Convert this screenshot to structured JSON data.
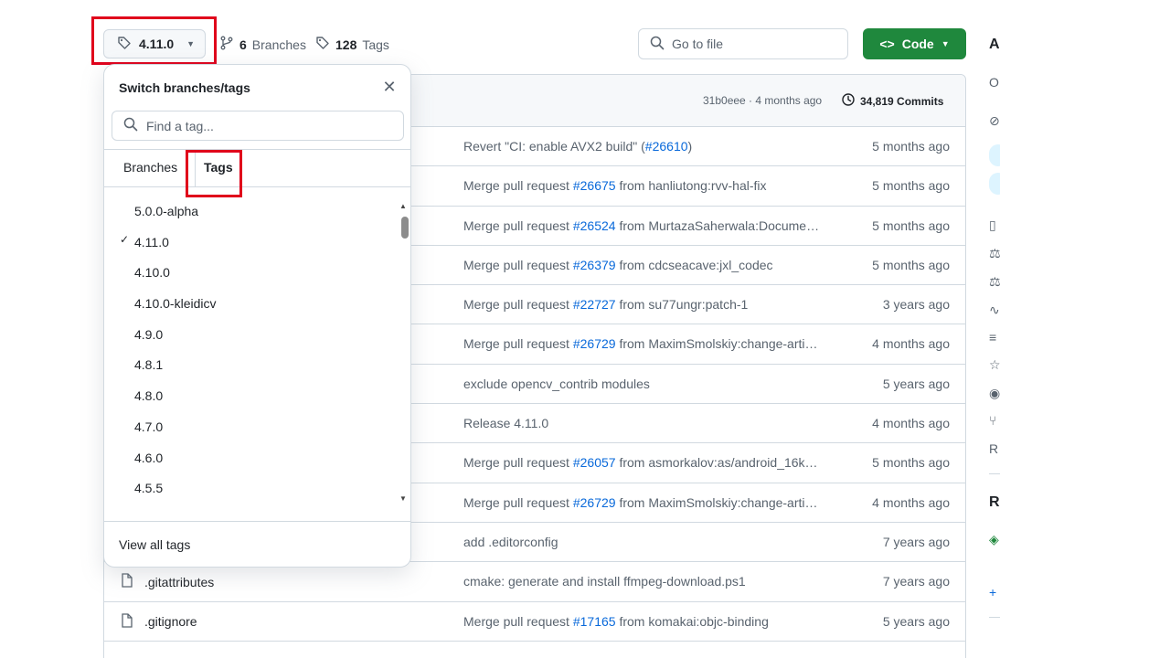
{
  "topbar": {
    "ref_label": "4.11.0",
    "branches_count": "6",
    "branches_label": "Branches",
    "tags_count": "128",
    "tags_label": "Tags",
    "goto_placeholder": "Go to file",
    "code_label": "Code"
  },
  "commit_header": {
    "last_commit": "31b0eee · 4 months ago",
    "commits_count": "34,819 Commits"
  },
  "rows": [
    {
      "name": "",
      "pre": "Revert \"CI: enable AVX2 build\" (",
      "link": "#26610",
      "post": ")",
      "age": "5 months ago"
    },
    {
      "name": "",
      "pre": "Merge pull request ",
      "link": "#26675",
      "post": " from hanliutong:rvv-hal-fix",
      "age": "5 months ago"
    },
    {
      "name": "",
      "pre": "Merge pull request ",
      "link": "#26524",
      "post": " from MurtazaSaherwala:Docume…",
      "age": "5 months ago"
    },
    {
      "name": "",
      "pre": "Merge pull request ",
      "link": "#26379",
      "post": " from cdcseacave:jxl_codec",
      "age": "5 months ago"
    },
    {
      "name": "",
      "pre": "Merge pull request ",
      "link": "#22727",
      "post": " from su77ungr:patch-1",
      "age": "3 years ago"
    },
    {
      "name": "",
      "pre": "Merge pull request ",
      "link": "#26729",
      "post": " from MaximSmolskiy:change-arti…",
      "age": "4 months ago"
    },
    {
      "name": "",
      "pre": "exclude opencv_contrib modules",
      "link": "",
      "post": "",
      "age": "5 years ago"
    },
    {
      "name": "",
      "pre": "Release 4.11.0",
      "link": "",
      "post": "",
      "age": "4 months ago"
    },
    {
      "name": "",
      "pre": "Merge pull request ",
      "link": "#26057",
      "post": " from asmorkalov:as/android_16k…",
      "age": "5 months ago"
    },
    {
      "name": "",
      "pre": "Merge pull request ",
      "link": "#26729",
      "post": " from MaximSmolskiy:change-arti…",
      "age": "4 months ago"
    },
    {
      "name": "",
      "pre": "add .editorconfig",
      "link": "",
      "post": "",
      "age": "7 years ago"
    },
    {
      "name": ".gitattributes",
      "pre": "cmake: generate and install ffmpeg-download.ps1",
      "link": "",
      "post": "",
      "age": "7 years ago"
    },
    {
      "name": ".gitignore",
      "pre": "Merge pull request ",
      "link": "#17165",
      "post": " from komakai:objc-binding",
      "age": "5 years ago"
    }
  ],
  "dropdown": {
    "title": "Switch branches/tags",
    "search_placeholder": "Find a tag...",
    "tab_branches": "Branches",
    "tab_tags": "Tags",
    "items": [
      {
        "label": "5.0.0-alpha",
        "selected": false
      },
      {
        "label": "4.11.0",
        "selected": true
      },
      {
        "label": "4.10.0",
        "selected": false
      },
      {
        "label": "4.10.0-kleidicv",
        "selected": false
      },
      {
        "label": "4.9.0",
        "selected": false
      },
      {
        "label": "4.8.1",
        "selected": false
      },
      {
        "label": "4.8.0",
        "selected": false
      },
      {
        "label": "4.7.0",
        "selected": false
      },
      {
        "label": "4.6.0",
        "selected": false
      },
      {
        "label": "4.5.5",
        "selected": false
      }
    ],
    "check_mark": "✓",
    "footer": "View all tags"
  },
  "sidebar_letters": [
    "A",
    "O",
    "R",
    "R"
  ],
  "sidebar_plus": "+",
  "colors": {
    "accent_green": "#1f883d",
    "link_blue": "#0969da",
    "highlight_red": "#e0001b",
    "muted": "#59636e"
  }
}
